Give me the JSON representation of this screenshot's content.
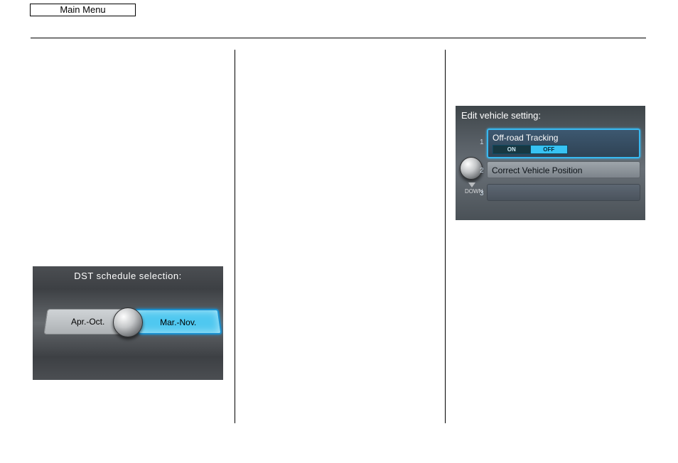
{
  "header": {
    "main_menu_label": "Main Menu"
  },
  "dst_panel": {
    "title": "DST schedule selection:",
    "option_left": "Apr.-Oct.",
    "option_right": "Mar.-Nov.",
    "selected": "Mar.-Nov."
  },
  "vehicle_panel": {
    "title": "Edit vehicle setting:",
    "dial_down_label": "DOWN",
    "rows": [
      {
        "index": "1",
        "label": "Off-road Tracking",
        "on": "ON",
        "off": "OFF",
        "selected": "OFF"
      },
      {
        "index": "2",
        "label": "Correct Vehicle Position"
      },
      {
        "index": "3",
        "label": ""
      }
    ]
  }
}
